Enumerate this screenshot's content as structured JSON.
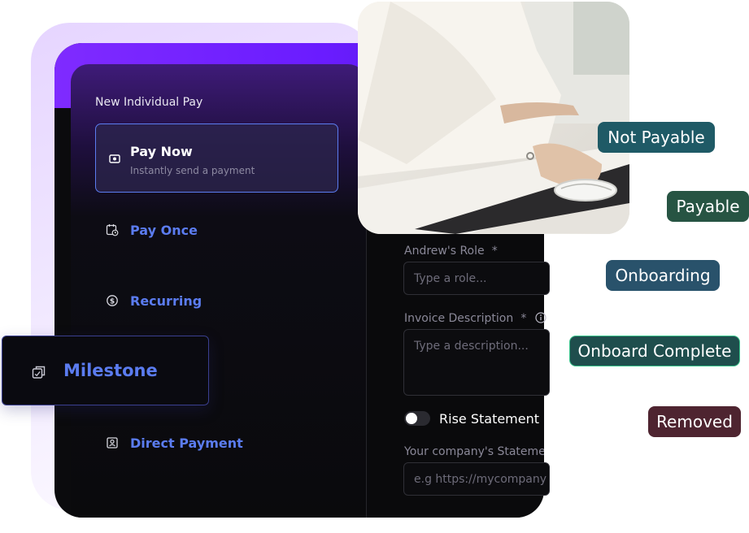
{
  "panel": {
    "title": "New Individual Pay"
  },
  "menu": {
    "pay_now": {
      "label": "Pay Now",
      "sub": "Instantly send a payment",
      "icon": "cash-icon"
    },
    "pay_once": {
      "label": "Pay Once",
      "icon": "calendar-clock-icon"
    },
    "recurring": {
      "label": "Recurring",
      "icon": "dollar-cycle-icon"
    },
    "milestone": {
      "label": "Milestone",
      "icon": "milestone-stack-icon"
    },
    "direct_payment": {
      "label": "Direct Payment",
      "icon": "id-card-icon"
    }
  },
  "form": {
    "role_label": "Andrew's Role",
    "role_required": "*",
    "role_placeholder": "Type a role...",
    "desc_label": "Invoice Description",
    "desc_required": "*",
    "desc_placeholder": "Type a description...",
    "toggle_label": "Rise Statement o",
    "toggle_on": false,
    "statement_label": "Your company's Statemen",
    "statement_placeholder": "e.g https://mycompany"
  },
  "badges": {
    "not_payable": "Not Payable",
    "payable": "Payable",
    "onboarding": "Onboarding",
    "onboard_complete": "Onboard Complete",
    "removed": "Removed"
  },
  "colors": {
    "accent": "#5b7cf0",
    "not_payable": "#1f5a66",
    "payable": "#275443",
    "onboarding": "#29526b",
    "onboard_complete": "#1f4e4d",
    "removed": "#4e2430"
  }
}
